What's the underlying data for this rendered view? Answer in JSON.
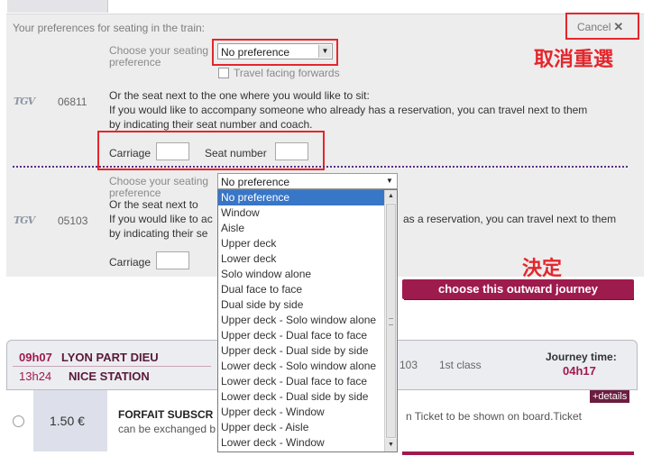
{
  "preferences": {
    "title": "Your preferences for seating in the train:",
    "cancel_label": "Cancel",
    "cancel_icon": "✕"
  },
  "annotations": {
    "cancel_reselect": "取消重選",
    "decide": "決定"
  },
  "segment1": {
    "train_logo": "TGV",
    "train_number": "06811",
    "seat_pref_label_line1": "Choose your seating",
    "seat_pref_label_line2": "preference",
    "seat_pref_value": "No preference",
    "travel_facing_label": "Travel facing forwards",
    "next_seat_heading": "Or the seat next to the one where you would like to sit:",
    "next_seat_text_line1": "If you would like to accompany someone who already has a reservation, you can travel next to them",
    "next_seat_text_line2": "by indicating their seat number and coach.",
    "carriage_label": "Carriage",
    "seat_number_label": "Seat number"
  },
  "segment2": {
    "train_logo": "TGV",
    "train_number": "05103",
    "seat_pref_label_line1": "Choose your seating",
    "seat_pref_label_line2": "preference",
    "seat_pref_value": "No preference",
    "next_seat_heading_prefix": "Or the seat next to",
    "next_seat_text_prefix": "If you would like to ac",
    "next_seat_text_suffix": "as a reservation, you can travel next to them",
    "next_seat_text_line2_prefix": "by indicating their se",
    "carriage_label": "Carriage"
  },
  "dropdown": {
    "options": [
      "No preference",
      "Window",
      "Aisle",
      "Upper deck",
      "Lower deck",
      "Solo window alone",
      "Dual face to face",
      "Dual side by side",
      "Upper deck - Solo window alone",
      "Upper deck - Dual face to face",
      "Upper deck - Dual side by side",
      "Lower deck - Solo window alone",
      "Lower deck - Dual face to face",
      "Lower deck - Dual side by side",
      "Upper deck - Window",
      "Upper deck - Aisle",
      "Lower deck - Window"
    ],
    "selected_index": 0
  },
  "choose_button_label": "choose this outward journey",
  "journey": {
    "departure_time": "09h07",
    "departure_station": "LYON PART DIEU",
    "arrival_time": "13h24",
    "arrival_station": "NICE STATION",
    "train_number_partial": "103",
    "class": "1st class",
    "journey_time_label": "Journey time:",
    "journey_time_value": "04h17",
    "details_label": "+details"
  },
  "fare": {
    "price": "1.50 €",
    "name_partial": "FORFAIT SUBSCR",
    "desc_partial": "can be exchanged b",
    "ticket_note": "n Ticket to be shown on board.Ticket"
  },
  "colors": {
    "brand": "#9e1b4d",
    "annotation_red": "#e4262c",
    "dropdown_highlight": "#3876c7"
  }
}
